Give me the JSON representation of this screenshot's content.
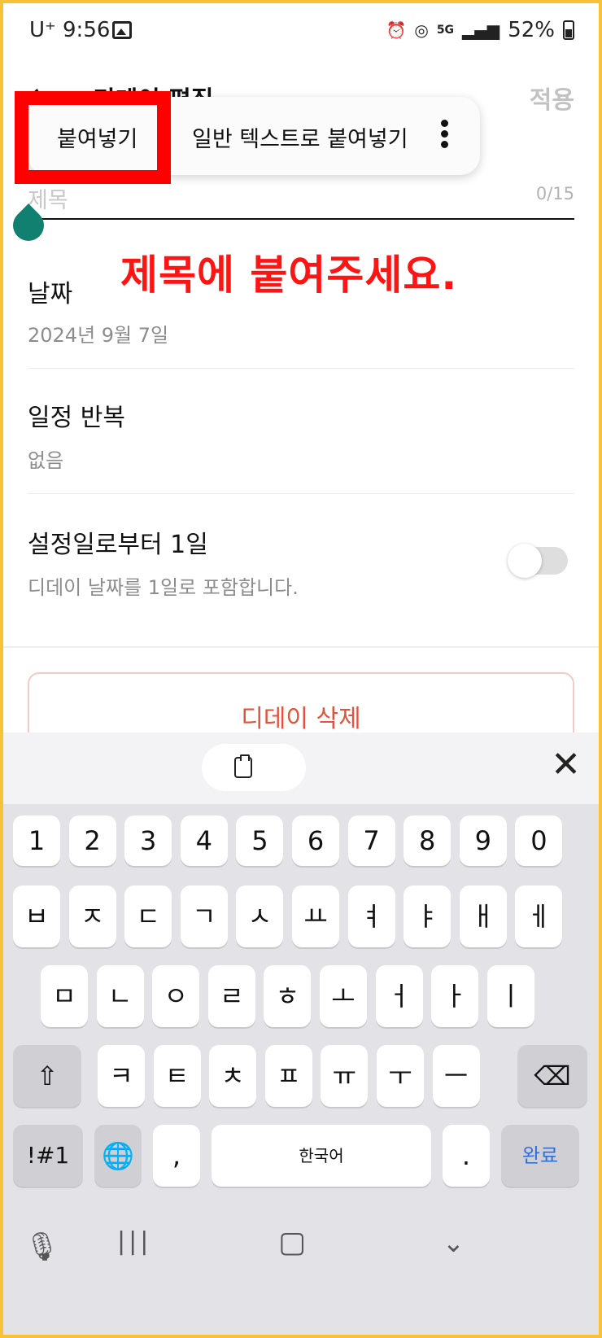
{
  "status_bar": {
    "carrier_time": "U⁺ 9:56",
    "battery": "52%",
    "network": "5G"
  },
  "header": {
    "back_icon": "back-arrow-icon",
    "title": "디데이 편집",
    "apply_label": "적용"
  },
  "context_menu": {
    "paste_label": "붙여넣기",
    "paste_plain_label": "일반 텍스트로 붙여넣기",
    "more_icon": "more-vertical-icon"
  },
  "title_field": {
    "placeholder": "제목",
    "counter": "0/15"
  },
  "annotation": "제목에 붙여주세요.",
  "date_row": {
    "title": "날짜",
    "value": "2024년 9월 7일"
  },
  "repeat_row": {
    "title": "일정 반복",
    "value": "없음"
  },
  "count_row": {
    "title": "설정일로부터 1일",
    "description": "디데이 날짜를 1일로 포함합니다.",
    "toggle_on": false
  },
  "delete_button": "디데이 삭제",
  "keyboard": {
    "numbers": [
      "1",
      "2",
      "3",
      "4",
      "5",
      "6",
      "7",
      "8",
      "9",
      "0"
    ],
    "row1": [
      "ㅂ",
      "ㅈ",
      "ㄷ",
      "ㄱ",
      "ㅅ",
      "ㅛ",
      "ㅕ",
      "ㅑ",
      "ㅐ",
      "ㅔ"
    ],
    "row2": [
      "ㅁ",
      "ㄴ",
      "ㅇ",
      "ㄹ",
      "ㅎ",
      "ㅗ",
      "ㅓ",
      "ㅏ",
      "ㅣ"
    ],
    "row3": [
      "ㅋ",
      "ㅌ",
      "ㅊ",
      "ㅍ",
      "ㅠ",
      "ㅜ",
      "ㅡ"
    ],
    "symbols_label": "!#1",
    "comma": ",",
    "space_label": "한국어",
    "period": ".",
    "done_label": "완료",
    "accent": "#2f6fd8"
  },
  "colors": {
    "frame": "#f6c23a",
    "annotation": "#ff1414",
    "handle": "#118071",
    "delete": "#e0553a"
  }
}
